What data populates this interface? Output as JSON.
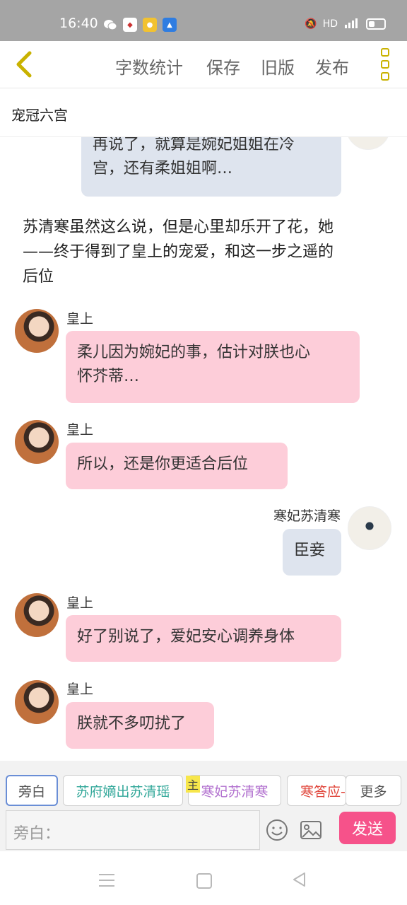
{
  "status": {
    "time": "16:40",
    "network": "HD",
    "signal": "4G"
  },
  "toolbar": {
    "back_icon": "chevron-left-icon",
    "word_count": "字数统计",
    "save": "保存",
    "old_version": "旧版",
    "publish": "发布",
    "menu_icon": "more-vertical-icon"
  },
  "story": {
    "title": "宠冠六宫"
  },
  "messages": {
    "m0": {
      "line1": "再说了，就算是婉妃姐姐在冷",
      "line2": "宫，还有柔姐姐啊…"
    },
    "narration": {
      "line1": "苏清寒虽然这么说，但是心里却乐开了花，她",
      "line2": "——终于得到了皇上的宠爱，和这一步之遥的",
      "line3": "后位"
    },
    "m1": {
      "speaker": "皇上",
      "line1": "柔儿因为婉妃的事，估计对朕也心",
      "line2": "怀芥蒂…"
    },
    "m2": {
      "speaker": "皇上",
      "text": "所以，还是你更适合后位"
    },
    "m3": {
      "speaker": "寒妃苏清寒",
      "text": "臣妾"
    },
    "m4": {
      "speaker": "皇上",
      "text": "好了别说了，爱妃安心调养身体"
    },
    "m5": {
      "speaker": "皇上",
      "text": "朕就不多叨扰了"
    }
  },
  "roles": {
    "narration": "旁白",
    "r1": "苏府嫡出苏清瑶",
    "main_tag": "主",
    "r2": "寒妃苏清寒",
    "r3": "寒答应-",
    "more": "更多"
  },
  "input": {
    "placeholder": "旁白：",
    "send": "发送"
  },
  "colors": {
    "accent": "#f6528a",
    "bubble_pink": "#fdcdd9",
    "bubble_blue": "#dee4ee"
  }
}
